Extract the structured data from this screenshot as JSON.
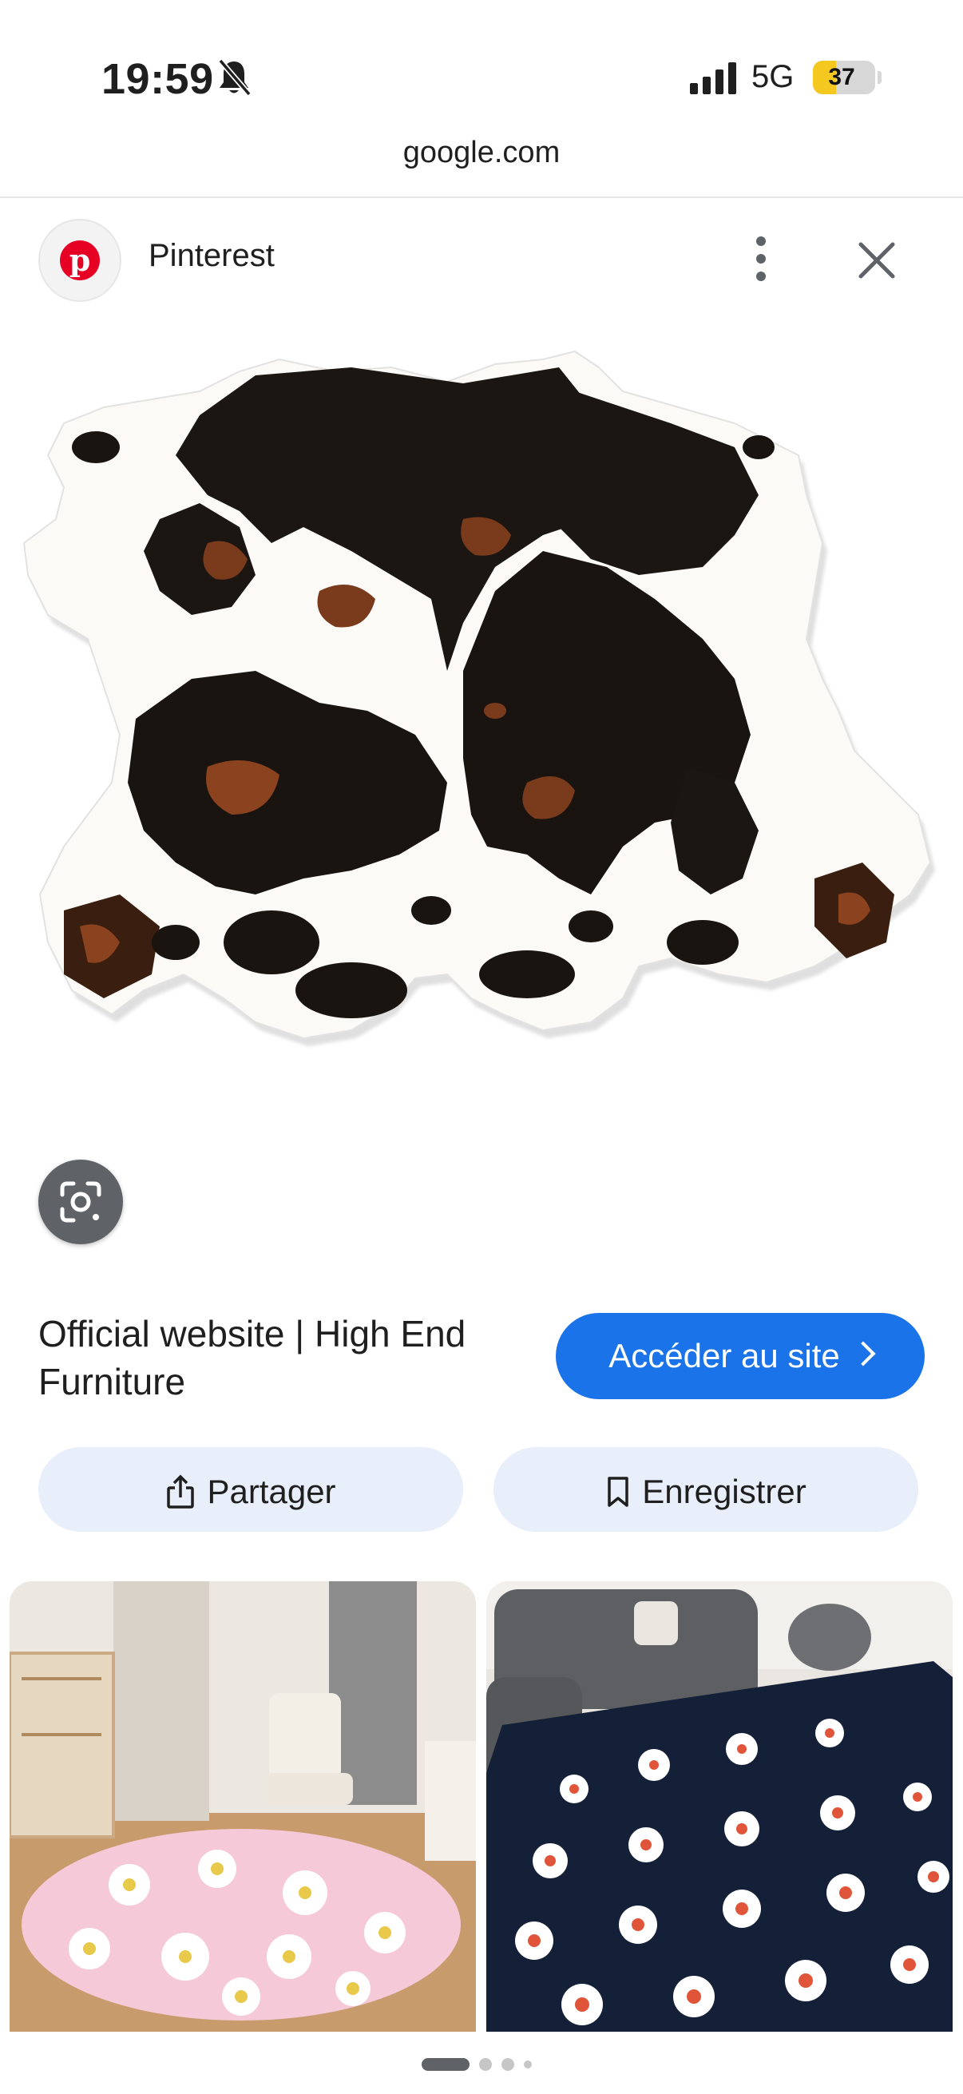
{
  "status_bar": {
    "time": "19:59",
    "network": "5G",
    "battery": "37",
    "battery_level": 0.37,
    "icons": [
      "bell-slash-icon",
      "signal-icon",
      "battery-icon"
    ]
  },
  "browser": {
    "url": "google.com"
  },
  "header": {
    "source": "Pinterest",
    "icons": [
      "pinterest-logo",
      "more-vert-icon",
      "close-icon"
    ]
  },
  "main_image": {
    "subject": "cowhide-rug",
    "icon": "google-lens-icon"
  },
  "result": {
    "title": "Official website | High End Furniture",
    "visit_label": "Accéder au site",
    "share_label": "Partager",
    "save_label": "Enregistrer"
  },
  "related": [
    {
      "subject": "round-pink-daisy-rug"
    },
    {
      "subject": "navy-daisy-rug"
    }
  ],
  "pager": {
    "count": 4,
    "active": 0
  },
  "colors": {
    "accent": "#1a73e8",
    "pill": "#e8effb",
    "pinterest": "#e60023",
    "battery": "#f4c81f"
  }
}
